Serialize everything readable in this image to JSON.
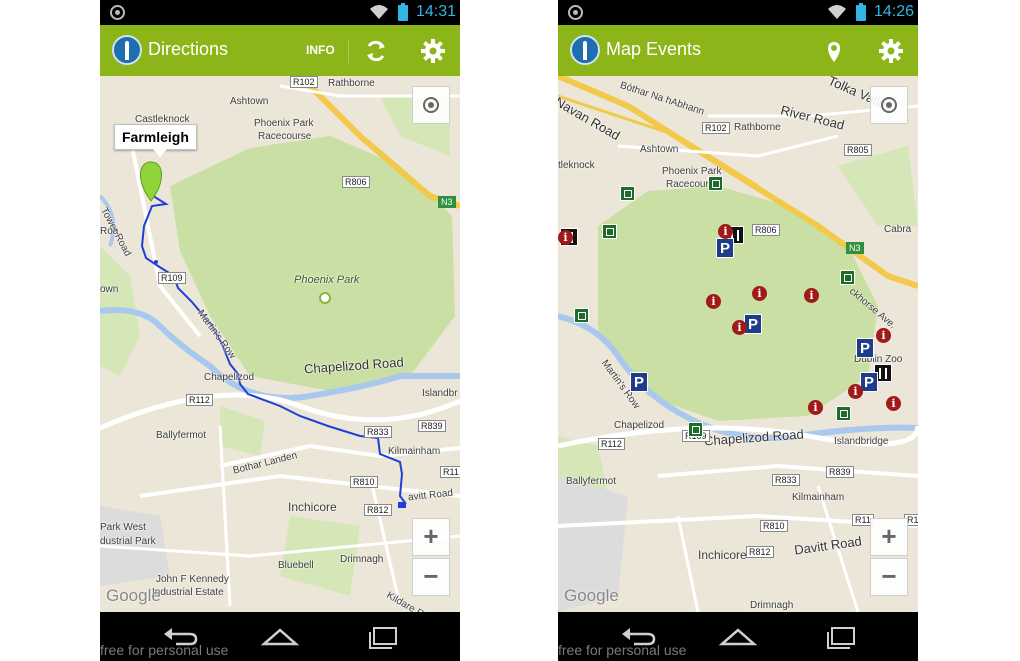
{
  "colors": {
    "accent": "#8cb519",
    "status_time": "#33b5e5",
    "route": "#1e40d6",
    "park": "#c9dfa3",
    "water": "#a9c8ee",
    "motorway": "#f2c94a"
  },
  "screens": [
    {
      "status": {
        "time": "14:31"
      },
      "actionbar": {
        "title": "Directions",
        "info": "INFO",
        "icons": [
          "refresh-icon",
          "settings-icon"
        ]
      },
      "map": {
        "callout": "Farmleigh",
        "labels": {
          "castleknock": "Castleknock",
          "ashtown": "Ashtown",
          "rathborne": "Rathborne",
          "phoenix_park_racecourse_1": "Phoenix Park",
          "phoenix_park_racecourse_2": "Racecourse",
          "phoenix_park": "Phoenix Park",
          "tower_road": "Tower Road",
          "martins_row": "Martin's Row",
          "chapelizod": "Chapelizod",
          "chapelizod_road": "Chapelizod Road",
          "islandbridge": "Islandbr",
          "ballyfermot": "Ballyfermot",
          "bothar_landen": "Bothar Landen",
          "kilmainham": "Kilmainham",
          "davitt_road": "avitt Road",
          "inchicore": "Inchicore",
          "park_west_1": "Park West",
          "park_west_2": "dustrial Park",
          "john_f_kennedy_1": "John F Kennedy",
          "john_f_kennedy_2": "Industrial Estate",
          "bluebell": "Bluebell",
          "drimnagh": "Drimnagh",
          "kildare_road": "Kildare Road",
          "own": "own",
          "roa": "Roa"
        },
        "shields": [
          "R102",
          "R806",
          "N3",
          "R109",
          "R112",
          "R833",
          "R839",
          "R810",
          "R812",
          "R11"
        ],
        "attribution": "Google",
        "zoom_in": "+",
        "zoom_out": "−"
      },
      "caption": "free for personal use"
    },
    {
      "status": {
        "time": "14:26"
      },
      "actionbar": {
        "title": "Map Events",
        "icons": [
          "map-pin-icon",
          "settings-icon"
        ]
      },
      "map": {
        "labels": {
          "navan_road": "Navan Road",
          "bothar_na_habhann": "Bóthar Na hAbhann",
          "river_road": "River Road",
          "tolka_valley": "Tolka Valley",
          "rathborne": "Rathborne",
          "ashtown": "Ashtown",
          "castleknock": "tleknock",
          "racecourse_1": "Phoenix Park",
          "racecourse_2": "Racecourse",
          "cabra": "Cabra",
          "chesterfield": "ckhorse Ave.",
          "dublin_zoo": "Dublin Zoo",
          "martins_row": "Martin's Row",
          "chapelizod": "Chapelizod",
          "chapelizod_road": "Chapelizod Road",
          "islandbridge": "Islandbridge",
          "ballyfermot": "Ballyfermot",
          "kilmainham": "Kilmainham",
          "inchicore": "Inchicore",
          "davitt_road": "Davitt Road",
          "drimnagh": "Drimnagh"
        },
        "shields": [
          "R102",
          "R805",
          "R806",
          "N3",
          "R109",
          "R112",
          "R833",
          "R839",
          "R810",
          "R812",
          "R11",
          "R1"
        ],
        "attribution": "Google",
        "zoom_in": "+",
        "zoom_out": "−",
        "events": {
          "info": "i",
          "parking": "P"
        }
      },
      "caption": "free for personal use"
    }
  ]
}
